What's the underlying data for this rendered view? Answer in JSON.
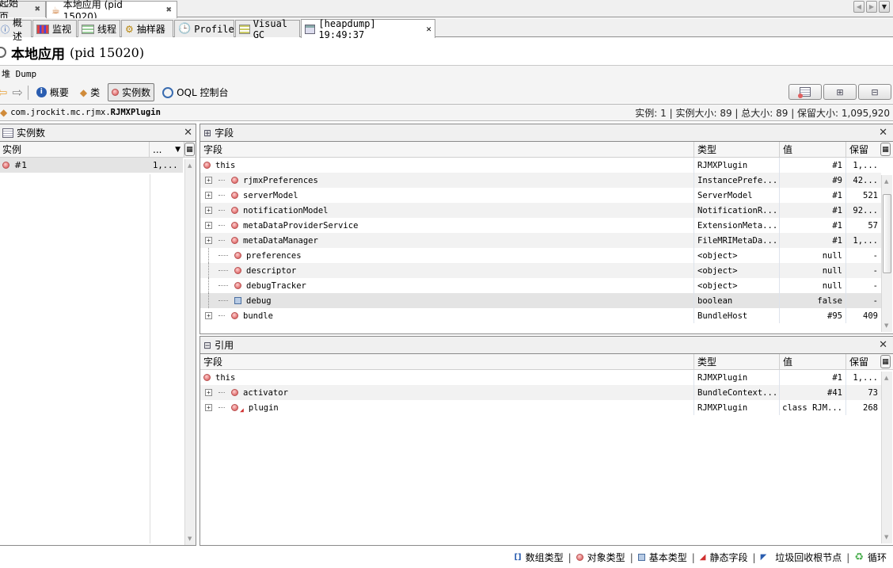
{
  "doc_tabs": [
    {
      "label": "起始页",
      "active": false
    },
    {
      "label": "本地应用 (pid 15020)",
      "active": true
    }
  ],
  "sub_tabs": [
    {
      "label": "概述",
      "icon": "info-icon"
    },
    {
      "label": "监视",
      "icon": "monitor-chart-icon"
    },
    {
      "label": "线程",
      "icon": "threads-icon"
    },
    {
      "label": "抽样器",
      "icon": "sampler-icon"
    },
    {
      "label": "Profiler",
      "icon": "clock-icon"
    },
    {
      "label": "Visual GC",
      "icon": "gc-icon"
    },
    {
      "label": "[heapdump] 19:49:37",
      "icon": "heapdump-icon",
      "active": true
    }
  ],
  "title": {
    "name": "本地应用",
    "pid": "(pid 15020)"
  },
  "heap_label": "堆 Dump",
  "toolbar": {
    "summary": "概要",
    "classes": "类",
    "instances": "实例数",
    "oql": "OQL 控制台"
  },
  "class_bar": {
    "package": "com.jrockit.mc.rjmx.",
    "class_name": "RJMXPlugin",
    "stats": "实例: 1  |  实例大小: 89  |  总大小: 89  |  保留大小: 1,095,920"
  },
  "instances_panel": {
    "title": "实例数",
    "col_instance": "实例",
    "col_more": "...",
    "rows": [
      {
        "name": "#1",
        "value": "1,..."
      }
    ]
  },
  "fields_panel": {
    "title": "字段",
    "columns": [
      "字段",
      "类型",
      "值",
      "保留"
    ],
    "rows": [
      {
        "name": "this",
        "type": "RJMXPlugin",
        "value": "#1",
        "retained": "1,...",
        "kind": "object",
        "expand": false,
        "root": true
      },
      {
        "name": "rjmxPreferences",
        "type": "InstancePrefe...",
        "value": "#9",
        "retained": "42...",
        "kind": "object",
        "expand": true
      },
      {
        "name": "serverModel",
        "type": "ServerModel",
        "value": "#1",
        "retained": "521",
        "kind": "object",
        "expand": true
      },
      {
        "name": "notificationModel",
        "type": "NotificationR...",
        "value": "#1",
        "retained": "92...",
        "kind": "object",
        "expand": true
      },
      {
        "name": "metaDataProviderService",
        "type": "ExtensionMeta...",
        "value": "#1",
        "retained": "57",
        "kind": "object",
        "expand": true
      },
      {
        "name": "metaDataManager",
        "type": "FileMRIMetaDa...",
        "value": "#1",
        "retained": "1,...",
        "kind": "object",
        "expand": true
      },
      {
        "name": "preferences",
        "type": "<object>",
        "value": "null",
        "retained": "-",
        "kind": "object",
        "expand": false
      },
      {
        "name": "descriptor",
        "type": "<object>",
        "value": "null",
        "retained": "-",
        "kind": "object",
        "expand": false
      },
      {
        "name": "debugTracker",
        "type": "<object>",
        "value": "null",
        "retained": "-",
        "kind": "object",
        "expand": false
      },
      {
        "name": "debug",
        "type": "boolean",
        "value": "false",
        "retained": "-",
        "kind": "primitive",
        "expand": false,
        "selected": true
      },
      {
        "name": "bundle",
        "type": "BundleHost",
        "value": "#95",
        "retained": "409",
        "kind": "object",
        "expand": true
      }
    ]
  },
  "references_panel": {
    "title": "引用",
    "columns": [
      "字段",
      "类型",
      "值",
      "保留"
    ],
    "rows": [
      {
        "name": "this",
        "type": "RJMXPlugin",
        "value": "#1",
        "retained": "1,...",
        "kind": "object",
        "expand": false,
        "root": true
      },
      {
        "name": "activator",
        "type": "BundleContext...",
        "value": "#41",
        "retained": "73",
        "kind": "object",
        "expand": true
      },
      {
        "name": "plugin",
        "type": "RJMXPlugin",
        "value": "class RJM...",
        "retained": "268",
        "kind": "static",
        "expand": true
      }
    ]
  },
  "legend": [
    {
      "label": "数组类型",
      "icon": "array-type-icon"
    },
    {
      "label": "对象类型",
      "icon": "object-type-icon"
    },
    {
      "label": "基本类型",
      "icon": "primitive-type-icon"
    },
    {
      "label": "静态字段",
      "icon": "static-field-icon"
    },
    {
      "label": "垃圾回收根节点",
      "icon": "gc-root-icon"
    },
    {
      "label": "循环",
      "icon": "loop-icon"
    }
  ],
  "colors": {
    "object": "#e07070",
    "primitive": "#b8cbe4",
    "loop": "#4caf50"
  }
}
